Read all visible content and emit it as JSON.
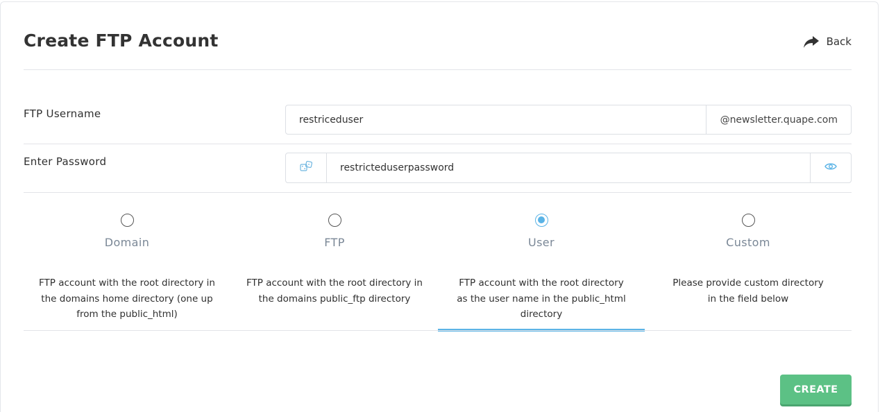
{
  "page": {
    "title": "Create FTP Account",
    "back_label": "Back"
  },
  "form": {
    "username": {
      "label": "FTP Username",
      "value": "restriceduser",
      "domain_suffix": "@newsletter.quape.com"
    },
    "password": {
      "label": "Enter Password",
      "value": "restricteduserpassword"
    }
  },
  "directory_options": [
    {
      "label": "Domain",
      "description": "FTP account with the root directory in the domains home directory (one up from the public_html)",
      "selected": false
    },
    {
      "label": "FTP",
      "description": "FTP account with the root directory in the domains public_ftp directory",
      "selected": false
    },
    {
      "label": "User",
      "description": "FTP account with the root directory as the user name in the public_html directory",
      "selected": true
    },
    {
      "label": "Custom",
      "description": "Please provide custom directory in the field below",
      "selected": false
    }
  ],
  "actions": {
    "create_label": "CREATE"
  },
  "colors": {
    "accent": "#5ab3e6",
    "create_button": "#5cc185"
  },
  "icons": {
    "back": "share-arrow-icon",
    "generate_password": "dice-icon",
    "show_password": "eye-icon"
  }
}
